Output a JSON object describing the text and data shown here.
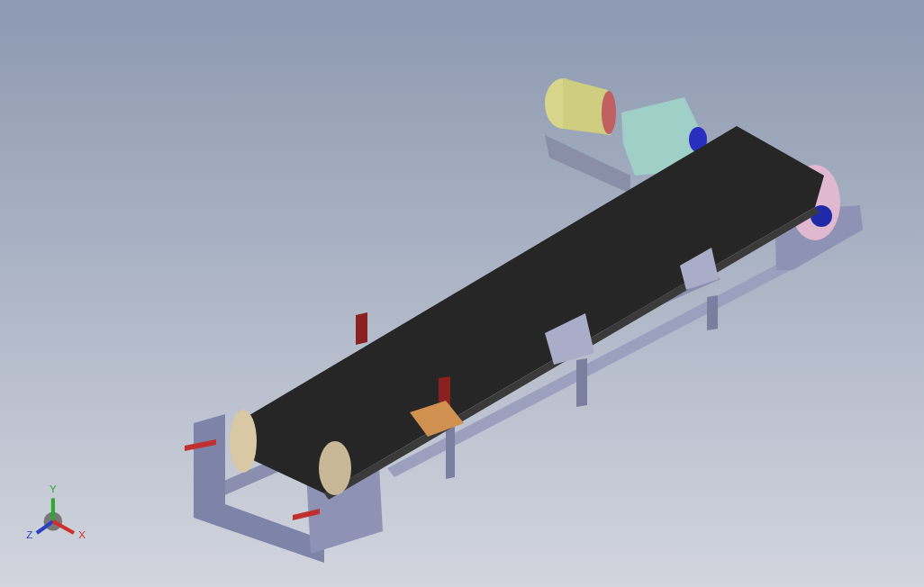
{
  "viewport": {
    "triad": {
      "axes": [
        {
          "label": "Y",
          "color": "#2fa82f"
        },
        {
          "label": "Z",
          "color": "#2c3fc4"
        },
        {
          "label": "X",
          "color": "#d0302a"
        }
      ]
    }
  }
}
